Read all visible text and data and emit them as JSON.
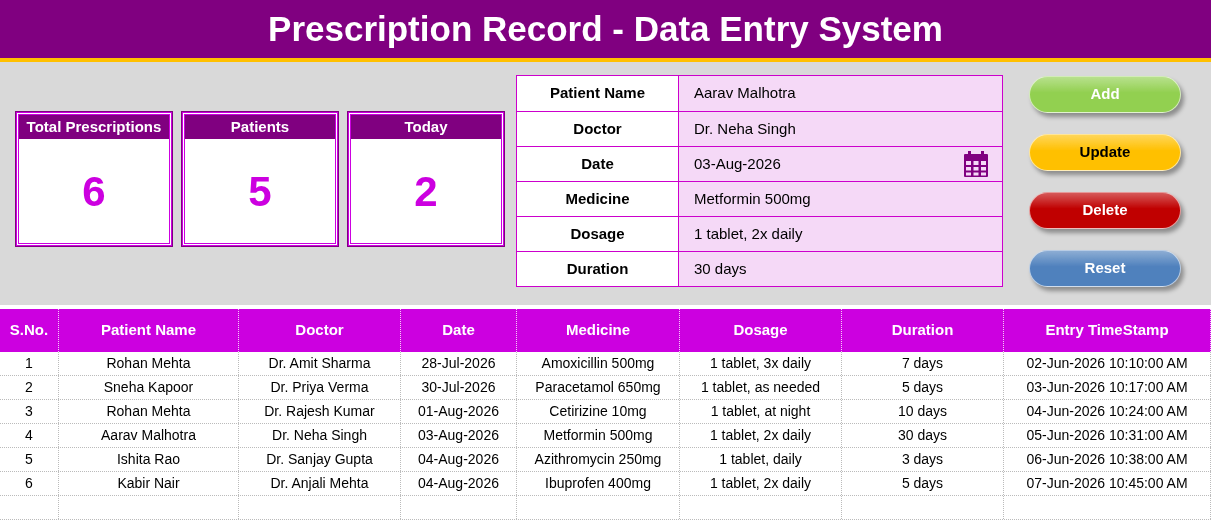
{
  "title": "Prescription Record - Data Entry System",
  "stats": [
    {
      "label": "Total Prescriptions",
      "value": "6"
    },
    {
      "label": "Patients",
      "value": "5"
    },
    {
      "label": "Today",
      "value": "2"
    }
  ],
  "form": [
    {
      "label": "Patient Name",
      "value": "Aarav Malhotra",
      "kind": "text"
    },
    {
      "label": "Doctor",
      "value": "Dr. Neha Singh",
      "kind": "text"
    },
    {
      "label": "Date",
      "value": "03-Aug-2026",
      "kind": "date"
    },
    {
      "label": "Medicine",
      "value": "Metformin 500mg",
      "kind": "text"
    },
    {
      "label": "Dosage",
      "value": "1 tablet, 2x daily",
      "kind": "text"
    },
    {
      "label": "Duration",
      "value": "30 days",
      "kind": "text"
    }
  ],
  "buttons": [
    {
      "label": "Add",
      "color": "#92d050"
    },
    {
      "label": "Update",
      "color": "#ffc000"
    },
    {
      "label": "Delete",
      "color": "#c00000"
    },
    {
      "label": "Reset",
      "color": "#4f81bd"
    }
  ],
  "table": {
    "columns": [
      "S.No.",
      "Patient Name",
      "Doctor",
      "Date",
      "Medicine",
      "Dosage",
      "Duration",
      "Entry TimeStamp"
    ],
    "rows": [
      [
        "1",
        "Rohan Mehta",
        "Dr. Amit Sharma",
        "28-Jul-2026",
        "Amoxicillin 500mg",
        "1 tablet, 3x daily",
        "7 days",
        "02-Jun-2026 10:10:00 AM"
      ],
      [
        "2",
        "Sneha Kapoor",
        "Dr. Priya Verma",
        "30-Jul-2026",
        "Paracetamol 650mg",
        "1 tablet, as needed",
        "5 days",
        "03-Jun-2026 10:17:00 AM"
      ],
      [
        "3",
        "Rohan Mehta",
        "Dr. Rajesh Kumar",
        "01-Aug-2026",
        "Cetirizine 10mg",
        "1 tablet, at night",
        "10 days",
        "04-Jun-2026 10:24:00 AM"
      ],
      [
        "4",
        "Aarav Malhotra",
        "Dr. Neha Singh",
        "03-Aug-2026",
        "Metformin 500mg",
        "1 tablet, 2x daily",
        "30 days",
        "05-Jun-2026 10:31:00 AM"
      ],
      [
        "5",
        "Ishita Rao",
        "Dr. Sanjay Gupta",
        "04-Aug-2026",
        "Azithromycin 250mg",
        "1 tablet, daily",
        "3 days",
        "06-Jun-2026 10:38:00 AM"
      ],
      [
        "6",
        "Kabir Nair",
        "Dr. Anjali Mehta",
        "04-Aug-2026",
        "Ibuprofen 400mg",
        "1 tablet, 2x daily",
        "5 days",
        "07-Jun-2026 10:45:00 AM"
      ]
    ]
  }
}
